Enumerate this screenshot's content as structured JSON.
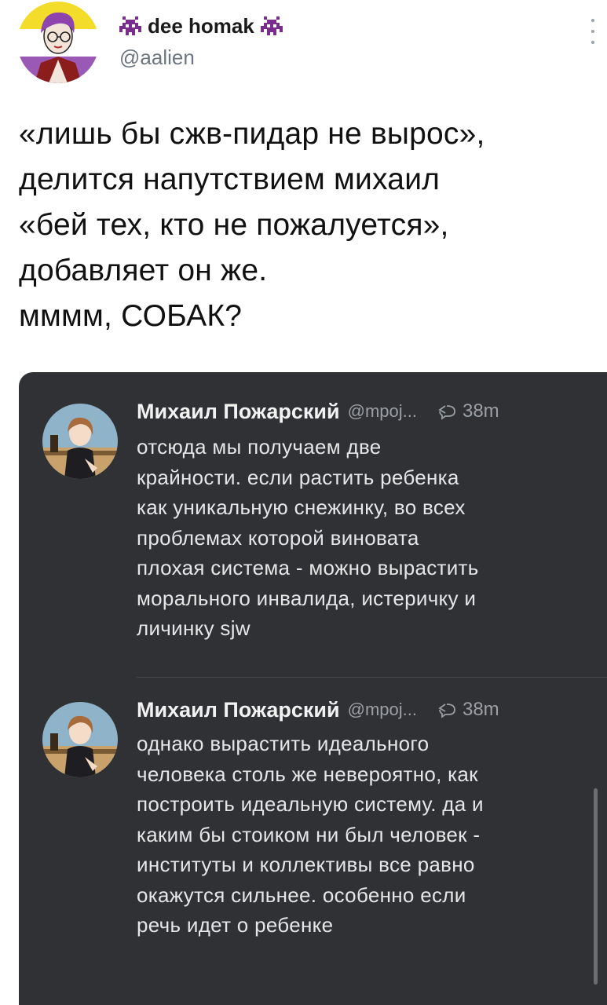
{
  "author": {
    "display_name": "dee homak",
    "handle": "@aalien",
    "avatar_icon": "avatar-icon",
    "badge_icon": "alien-invader-icon"
  },
  "tweet": {
    "lines": [
      "«лишь бы сжв-пидар не вырос»,",
      "делится напутствием михаил",
      "«бей тех, кто не пожалуется»,",
      "добавляет он же.",
      "мммм, СОБАК?"
    ]
  },
  "embedded_screenshot": {
    "background": "#2f3135",
    "replies": [
      {
        "name": "Михаил Пожарский",
        "handle": "@mpoj...",
        "reply_icon": "reply-icon",
        "time": "38m",
        "lines": [
          "отсюда мы получаем две",
          "крайности. если растить ребенка",
          "как уникальную снежинку, во всех",
          "проблемах которой виновата",
          "плохая система - можно вырастить",
          "морального инвалида, истеричку и",
          "личинку sjw"
        ]
      },
      {
        "name": "Михаил Пожарский",
        "handle": "@mpoj...",
        "reply_icon": "reply-icon",
        "time": "38m",
        "lines": [
          "однако вырастить идеального",
          "человека столь же невероятно, как",
          "построить идеальную систему. да и",
          "каким бы стоиком ни был человек -",
          "институты и коллективы все равно",
          "окажутся сильнее. особенно если",
          "речь идет о ребенке"
        ]
      }
    ]
  }
}
